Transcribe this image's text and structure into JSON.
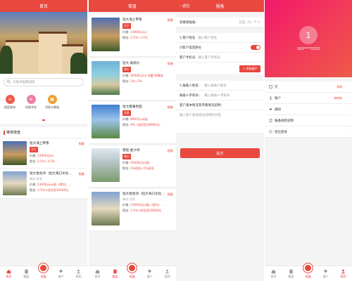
{
  "colors": {
    "accent": "#e8483e",
    "profile_gradient_start": "#f2186a",
    "profile_gradient_end": "#f05a4a"
  },
  "screen1": {
    "title": "首页",
    "search_placeholder": "大陆中国家园值",
    "quick_links": [
      {
        "label": "楼盘查询",
        "icon": "house-icon",
        "color": "#f05a4a"
      },
      {
        "label": "地图寻房",
        "icon": "send-icon",
        "color": "#f07fa8"
      },
      {
        "label": "贷款计算器",
        "icon": "calculator-icon",
        "color": "#f0a030"
      }
    ],
    "section_title": "推荐楼盘",
    "listings": [
      {
        "name": "恒大海上帝景",
        "badge": "万宁",
        "report": "报备",
        "price_label": "价格:",
        "price": "14000元/㎡",
        "comm_label": "佣金:",
        "comm": "2.5%~3.5%"
      },
      {
        "name": "恒大悦龙湾（恒大海口文化...",
        "tag": "海口  住宅",
        "report": "报备",
        "price_label": "价格:",
        "price": "13000元/㎡起（套内）...",
        "comm_label": "佣金:",
        "comm": "3.5%+成交奖30000元"
      }
    ]
  },
  "screen2": {
    "title": "楼盘",
    "listings": [
      {
        "name": "恒大海上帝景",
        "badge": "万宁",
        "report": "报备",
        "price_label": "价格:",
        "price": "14000元/㎡",
        "comm_label": "佣金:",
        "comm": "2.5%~3.5%"
      },
      {
        "name": "恒大·美丽沙",
        "badge": "海口",
        "report": "报备",
        "price_label": "价格:",
        "price": "20000元/㎡ 别墅:特惠房",
        "comm_label": "佣金:",
        "comm": "2%~3%"
      },
      {
        "name": "恒大御澜世园",
        "badge": "文昌",
        "report": "报备",
        "price_label": "价格:",
        "price": "8900元/㎡起",
        "comm_label": "佣金:",
        "comm": "4%（成交奖30000元）"
      },
      {
        "name": "碧桂·金沙湾",
        "badge": "海口",
        "report": "报备",
        "price_label": "价格:",
        "price": "25000元/㎡起",
        "comm_label": "佣金:",
        "comm": "3%现金+1%返现"
      },
      {
        "name": "恒大悦龙湾（恒大海口文化...",
        "tag": "海口  住宅",
        "report": "报备",
        "price_label": "价格:",
        "price": "13000元/㎡起（套内）...",
        "comm_label": "佣金:",
        "comm": "3.5%+成交奖30000元"
      }
    ]
  },
  "screen3": {
    "back": "返回",
    "title": "报备",
    "project_label": "您楼盘报备：",
    "project_value": "已选（0）个 >",
    "client_name_label": "1.客户姓名",
    "client_name_ph": "输入客户姓名",
    "hide_phone_label": "☑客户电话隐号",
    "client_phone_label": "客户手机号",
    "client_phone_ph": "输入客户手机号",
    "add_client": "+ 添加客户",
    "agent_name_label": "1.报备人姓名：",
    "agent_name_ph": "输入报备人姓名",
    "agent_phone_label": "报备人手机号：",
    "agent_phone_ph": "输入报备人手机号",
    "note_label": "客户基本情况及带看情况说明：",
    "note_ph": "输入客户基本情况说明的文档",
    "submit": "提交"
  },
  "screen4": {
    "avatar_letter": "1",
    "phone": "183****3333",
    "menu": [
      {
        "label": "元",
        "value": "修改",
        "icon": "list-icon"
      },
      {
        "label": "账户",
        "value": "待审核",
        "icon": "user-icon"
      },
      {
        "label": "通知",
        "value": "",
        "icon": "bell-icon"
      },
      {
        "label": "报备规则说明",
        "value": "",
        "icon": "doc-icon"
      },
      {
        "label": "退出登录",
        "value": "",
        "icon": "logout-icon"
      }
    ]
  },
  "tabbar": [
    {
      "label": "首页",
      "icon": "home-icon"
    },
    {
      "label": "楼盘",
      "icon": "building-icon"
    },
    {
      "label": "报备",
      "icon": "report-icon"
    },
    {
      "label": "客户",
      "icon": "client-icon"
    },
    {
      "label": "我的",
      "icon": "me-icon"
    }
  ]
}
